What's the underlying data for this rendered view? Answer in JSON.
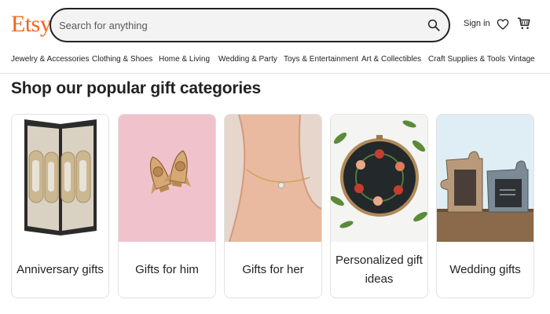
{
  "brand": {
    "logo": "Etsy",
    "accent": "#F1641E"
  },
  "search": {
    "placeholder": "Search for anything",
    "icon": "search-icon"
  },
  "header": {
    "signin_label": "Sign in",
    "favorites_icon": "heart-icon",
    "cart_icon": "cart-icon"
  },
  "nav": {
    "items": [
      {
        "label": "Jewelry & Accessories"
      },
      {
        "label": "Clothing & Shoes"
      },
      {
        "label": "Home & Living"
      },
      {
        "label": "Wedding & Party"
      },
      {
        "label": "Toys & Entertainment"
      },
      {
        "label": "Art & Collectibles"
      },
      {
        "label": "Craft Supplies & Tools"
      },
      {
        "label": "Vintage"
      }
    ]
  },
  "main": {
    "title": "Shop our popular gift categories",
    "categories": [
      {
        "label": "Anniversary gifts"
      },
      {
        "label": "Gifts for him"
      },
      {
        "label": "Gifts for her"
      },
      {
        "label": "Personalized gift ideas"
      },
      {
        "label": "Wedding gifts"
      }
    ]
  }
}
